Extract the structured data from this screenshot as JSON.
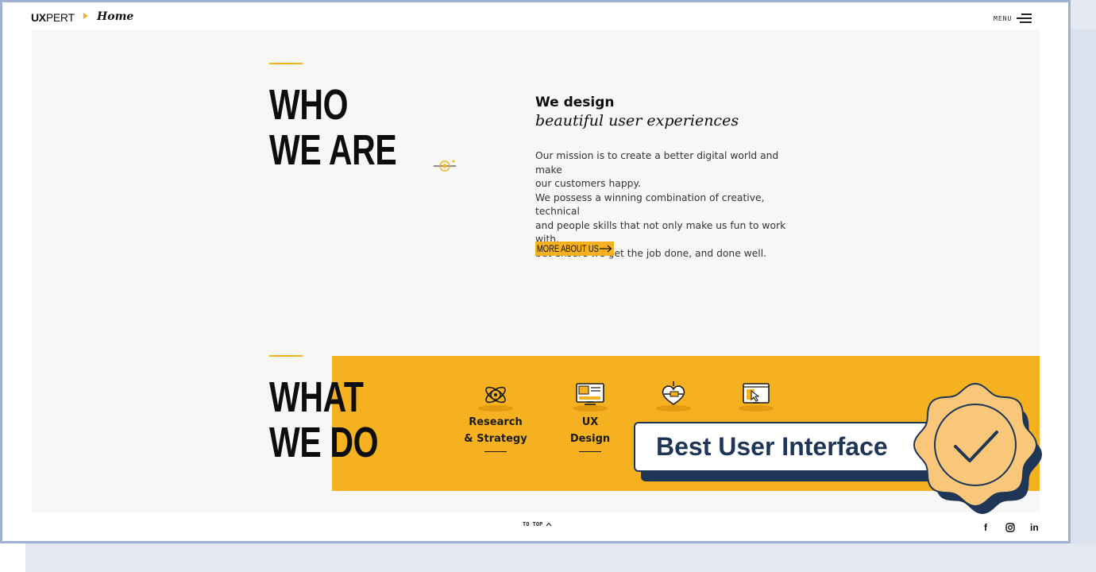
{
  "header": {
    "logo_bold": "UX",
    "logo_light": "PERT",
    "breadcrumb": "Home",
    "menu_label": "MENU"
  },
  "about": {
    "title_line1": "WHO",
    "title_line2": "WE ARE",
    "tagline_bold": "We design",
    "tagline_italic": "beautiful user experiences",
    "paragraph_lines": [
      "Our mission is to create a better digital world and make",
      "our customers happy.",
      "We possess a winning combination of creative, technical",
      "and people skills that not only make us fun to work with,",
      "but ensure we get the job done, and done well."
    ],
    "cta_label": "MORE ABOUT US"
  },
  "services": {
    "title_line1": "WHAT",
    "title_line2": "WE DO",
    "items": [
      {
        "icon": "research-atom-icon",
        "label_line1": "Research",
        "label_line2": "& Strategy"
      },
      {
        "icon": "ux-monitor-icon",
        "label_line1": "UX",
        "label_line2": "Design"
      },
      {
        "icon": "heart-pencil-icon",
        "label_line1": "",
        "label_line2": ""
      },
      {
        "icon": "browser-cursor-icon",
        "label_line1": "",
        "label_line2": ""
      }
    ]
  },
  "badge": {
    "text": "Best User Interface",
    "seal_icon": "checkmark-seal-icon"
  },
  "footer": {
    "to_top_label": "TO TOP",
    "social": [
      "f",
      "instagram",
      "in"
    ]
  },
  "colors": {
    "accent_yellow": "#f5b120",
    "navy": "#1f3657",
    "seal_fill": "#f9c77a",
    "frame_border": "#9fb2cf"
  }
}
